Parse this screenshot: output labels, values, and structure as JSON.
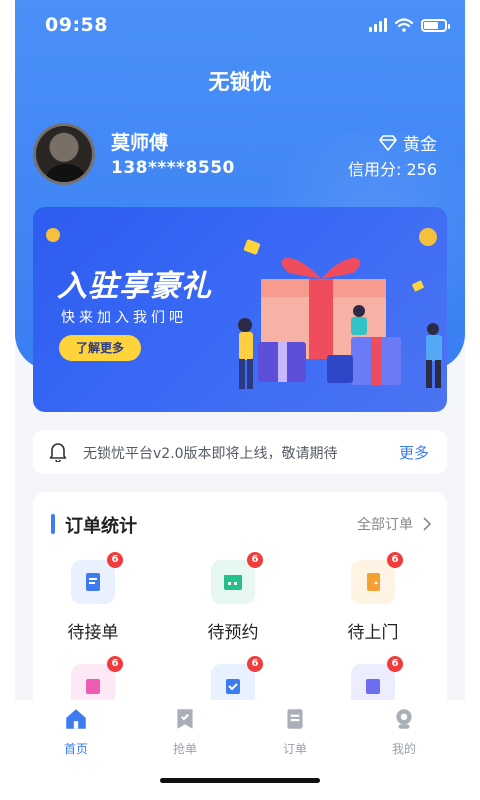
{
  "status_bar": {
    "time": "09:58"
  },
  "app": {
    "title": "无锁忧"
  },
  "user": {
    "name": "莫师傅",
    "phone": "138****8550",
    "level": "黄金",
    "credit_label": "信用分:",
    "credit_value": "256"
  },
  "banner": {
    "title": "入驻享豪礼",
    "subtitle": "快来加入我们吧",
    "button_label": "了解更多"
  },
  "notice": {
    "text": "无锁忧平台v2.0版本即将上线，敬请期待",
    "more_label": "更多"
  },
  "orders": {
    "title": "订单统计",
    "all_label": "全部订单",
    "items": [
      {
        "label": "待接单",
        "badge": "6",
        "color": "#e9f1ff",
        "icon_color": "#3e7bf0",
        "icon": "clipboard-icon"
      },
      {
        "label": "待预约",
        "badge": "6",
        "color": "#e6f8f1",
        "icon_color": "#22c08a",
        "icon": "calendar-icon"
      },
      {
        "label": "待上门",
        "badge": "6",
        "color": "#fff3e3",
        "icon_color": "#f5a033",
        "icon": "door-icon"
      },
      {
        "label": "",
        "badge": "6",
        "color": "#fde9f5",
        "icon_color": "#ef5db2",
        "icon": "box-icon"
      },
      {
        "label": "",
        "badge": "6",
        "color": "#e8f1ff",
        "icon_color": "#3e7bf0",
        "icon": "check-box-icon"
      },
      {
        "label": "",
        "badge": "6",
        "color": "#ecedff",
        "icon_color": "#6b6ef0",
        "icon": "tag-icon"
      }
    ]
  },
  "tabbar": {
    "items": [
      {
        "label": "首页",
        "active": true,
        "icon": "home-icon"
      },
      {
        "label": "抢单",
        "active": false,
        "icon": "grab-order-icon"
      },
      {
        "label": "订单",
        "active": false,
        "icon": "order-icon"
      },
      {
        "label": "我的",
        "active": false,
        "icon": "profile-icon"
      }
    ]
  },
  "colors": {
    "primary": "#3e7bf0",
    "badge": "#f23c3c",
    "banner_button": "#ffd43b"
  }
}
